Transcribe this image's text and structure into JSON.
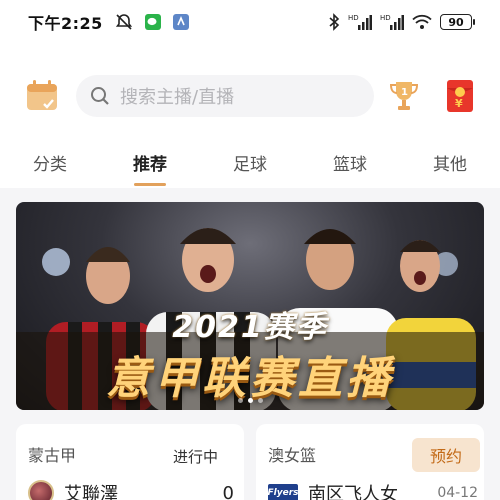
{
  "status_bar": {
    "time": "下午2:25",
    "signal_1_tag": "HD",
    "signal_2_tag": "HD",
    "battery": "90"
  },
  "header": {
    "search_placeholder": "搜索主播/直播"
  },
  "tabs": [
    {
      "label": "分类",
      "active": false
    },
    {
      "label": "推荐",
      "active": true
    },
    {
      "label": "足球",
      "active": false
    },
    {
      "label": "篮球",
      "active": false
    },
    {
      "label": "其他",
      "active": false
    }
  ],
  "banner": {
    "year_text": "2021赛季",
    "main_text": "意甲联赛直播",
    "slide_count": 3,
    "active_slide": 2
  },
  "cards": {
    "left": {
      "league": "蒙古甲",
      "status": "进行中",
      "team": "艾聯澤",
      "score": "0"
    },
    "right": {
      "league": "澳女篮",
      "book_label": "预约",
      "logo_text": "Flyers",
      "team": "南区飞人女",
      "date": "04-12"
    }
  },
  "colors": {
    "accent": "#e2a15c",
    "book_bg": "#f7e4cf",
    "book_text": "#c36a17"
  }
}
